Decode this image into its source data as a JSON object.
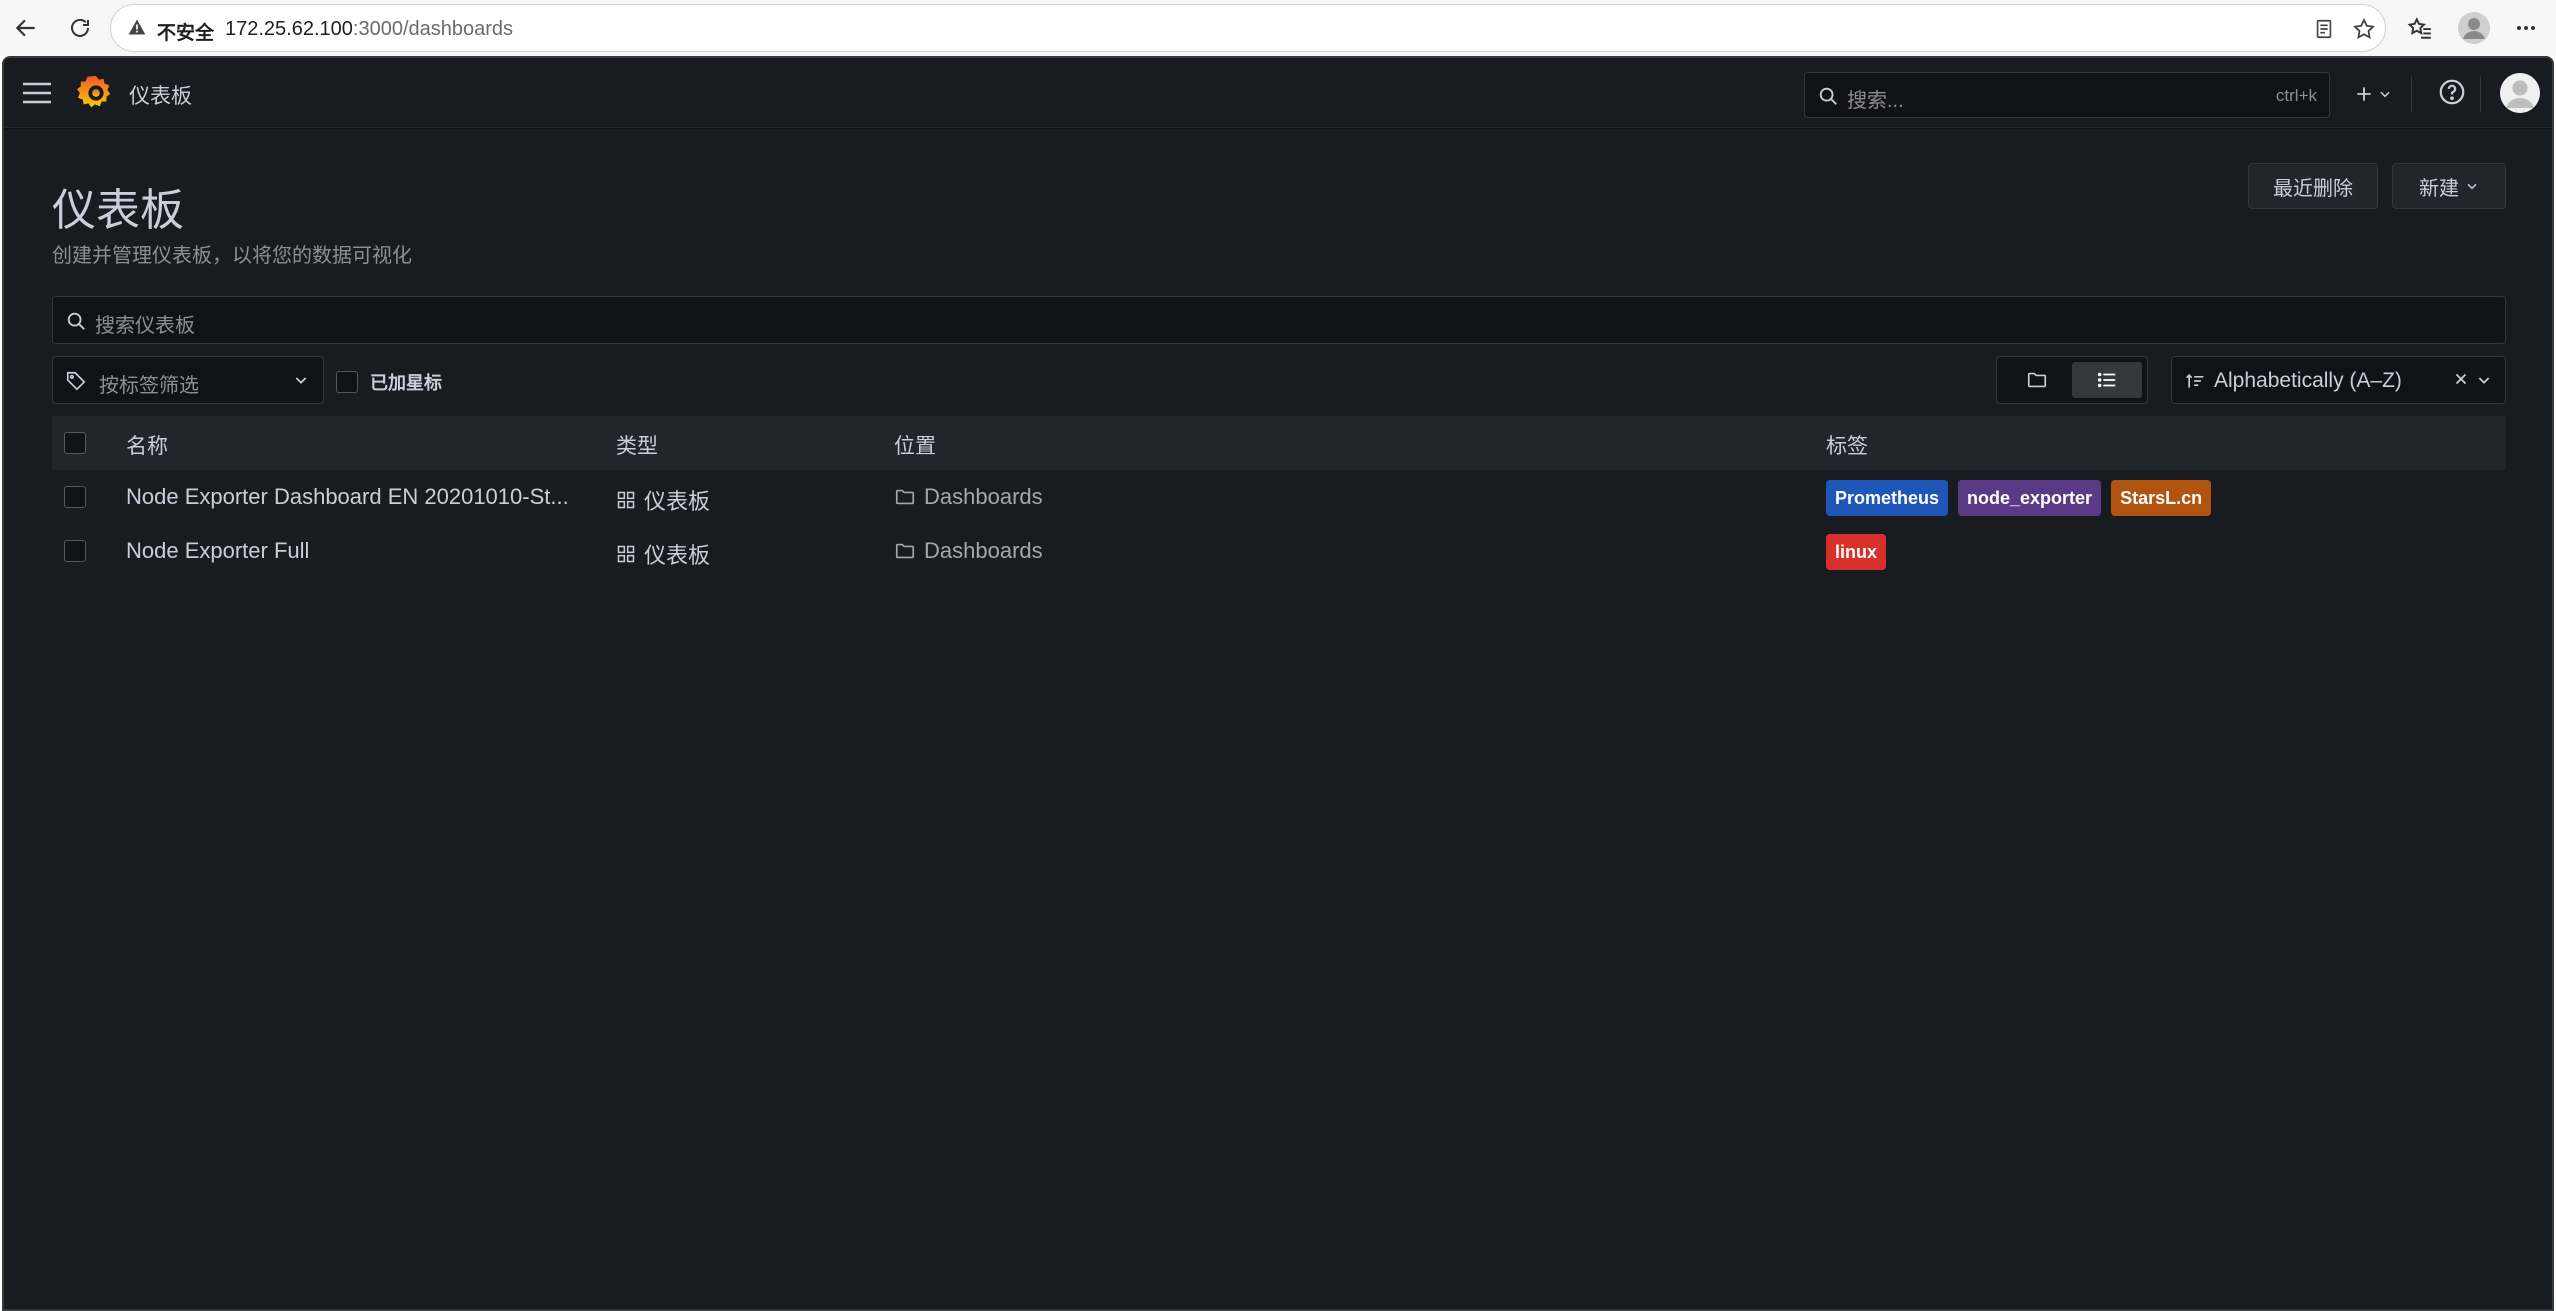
{
  "browser": {
    "insecure_label": "不安全",
    "url_host": "172.25.62.100",
    "url_path": ":3000/dashboards"
  },
  "nav": {
    "breadcrumb": "仪表板",
    "search_placeholder": "搜索...",
    "search_shortcut": "ctrl+k"
  },
  "page": {
    "title": "仪表板",
    "subtitle": "创建并管理仪表板，以将您的数据可视化",
    "recently_deleted_label": "最近删除",
    "new_label": "新建"
  },
  "filters": {
    "search_placeholder": "搜索仪表板",
    "tag_filter_placeholder": "按标签筛选",
    "starred_label": "已加星标",
    "sort_value": "Alphabetically (A–Z)",
    "active_view": "list"
  },
  "table": {
    "headers": {
      "name": "名称",
      "type": "类型",
      "location": "位置",
      "tags": "标签"
    },
    "rows": [
      {
        "name": "Node Exporter Dashboard EN 20201010-St...",
        "type": "仪表板",
        "location": "Dashboards",
        "tags": [
          {
            "label": "Prometheus",
            "color": "#1f57b8"
          },
          {
            "label": "node_exporter",
            "color": "#5a3a86"
          },
          {
            "label": "StarsL.cn",
            "color": "#b1540f"
          }
        ]
      },
      {
        "name": "Node Exporter Full",
        "type": "仪表板",
        "location": "Dashboards",
        "tags": [
          {
            "label": "linux",
            "color": "#d8312b"
          }
        ]
      }
    ]
  }
}
